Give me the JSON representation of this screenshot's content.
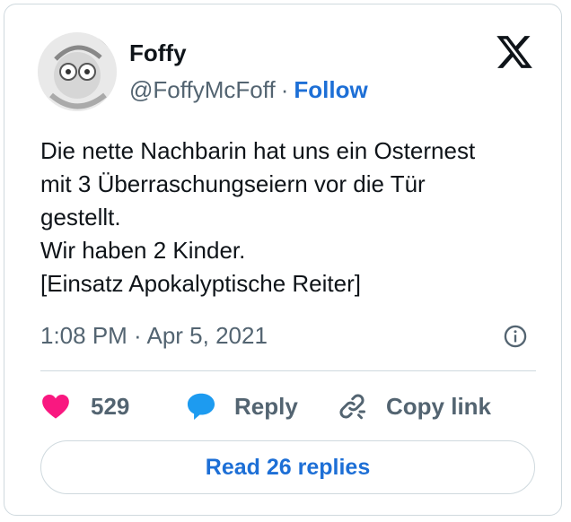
{
  "author": {
    "display_name": "Foffy",
    "handle": "@FoffyMcFoff",
    "separator": "·",
    "follow_label": "Follow"
  },
  "tweet": {
    "lines": [
      "Die nette Nachbarin hat uns ein Osternest",
      "mit 3 Überraschungseiern vor die Tür",
      "gestellt.",
      "Wir haben 2 Kinder.",
      "[Einsatz Apokalyptische Reiter]"
    ],
    "timestamp": "1:08 PM · Apr 5, 2021"
  },
  "actions": {
    "like_count": "529",
    "reply_label": "Reply",
    "copy_link_label": "Copy link"
  },
  "footer": {
    "read_replies_label": "Read 26 replies"
  },
  "icons": {
    "brand": "x-logo-icon",
    "info": "info-icon",
    "like": "heart-icon",
    "reply": "speech-bubble-icon",
    "copy_link": "link-icon"
  },
  "colors": {
    "heart": "#f91880",
    "reply_bubble": "#1d9bf0",
    "link_accent": "#1d6fd6",
    "muted_text": "#536471",
    "border": "#cfd9de"
  }
}
